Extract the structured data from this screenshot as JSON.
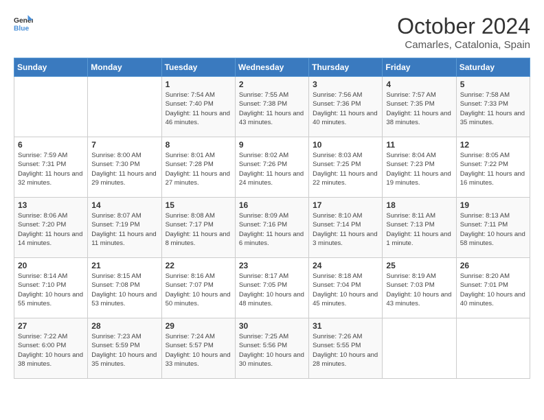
{
  "header": {
    "logo_general": "General",
    "logo_blue": "Blue",
    "title": "October 2024",
    "location": "Camarles, Catalonia, Spain"
  },
  "calendar": {
    "days_of_week": [
      "Sunday",
      "Monday",
      "Tuesday",
      "Wednesday",
      "Thursday",
      "Friday",
      "Saturday"
    ],
    "weeks": [
      [
        {
          "day": "",
          "sunrise": "",
          "sunset": "",
          "daylight": ""
        },
        {
          "day": "",
          "sunrise": "",
          "sunset": "",
          "daylight": ""
        },
        {
          "day": "1",
          "sunrise": "Sunrise: 7:54 AM",
          "sunset": "Sunset: 7:40 PM",
          "daylight": "Daylight: 11 hours and 46 minutes."
        },
        {
          "day": "2",
          "sunrise": "Sunrise: 7:55 AM",
          "sunset": "Sunset: 7:38 PM",
          "daylight": "Daylight: 11 hours and 43 minutes."
        },
        {
          "day": "3",
          "sunrise": "Sunrise: 7:56 AM",
          "sunset": "Sunset: 7:36 PM",
          "daylight": "Daylight: 11 hours and 40 minutes."
        },
        {
          "day": "4",
          "sunrise": "Sunrise: 7:57 AM",
          "sunset": "Sunset: 7:35 PM",
          "daylight": "Daylight: 11 hours and 38 minutes."
        },
        {
          "day": "5",
          "sunrise": "Sunrise: 7:58 AM",
          "sunset": "Sunset: 7:33 PM",
          "daylight": "Daylight: 11 hours and 35 minutes."
        }
      ],
      [
        {
          "day": "6",
          "sunrise": "Sunrise: 7:59 AM",
          "sunset": "Sunset: 7:31 PM",
          "daylight": "Daylight: 11 hours and 32 minutes."
        },
        {
          "day": "7",
          "sunrise": "Sunrise: 8:00 AM",
          "sunset": "Sunset: 7:30 PM",
          "daylight": "Daylight: 11 hours and 29 minutes."
        },
        {
          "day": "8",
          "sunrise": "Sunrise: 8:01 AM",
          "sunset": "Sunset: 7:28 PM",
          "daylight": "Daylight: 11 hours and 27 minutes."
        },
        {
          "day": "9",
          "sunrise": "Sunrise: 8:02 AM",
          "sunset": "Sunset: 7:26 PM",
          "daylight": "Daylight: 11 hours and 24 minutes."
        },
        {
          "day": "10",
          "sunrise": "Sunrise: 8:03 AM",
          "sunset": "Sunset: 7:25 PM",
          "daylight": "Daylight: 11 hours and 22 minutes."
        },
        {
          "day": "11",
          "sunrise": "Sunrise: 8:04 AM",
          "sunset": "Sunset: 7:23 PM",
          "daylight": "Daylight: 11 hours and 19 minutes."
        },
        {
          "day": "12",
          "sunrise": "Sunrise: 8:05 AM",
          "sunset": "Sunset: 7:22 PM",
          "daylight": "Daylight: 11 hours and 16 minutes."
        }
      ],
      [
        {
          "day": "13",
          "sunrise": "Sunrise: 8:06 AM",
          "sunset": "Sunset: 7:20 PM",
          "daylight": "Daylight: 11 hours and 14 minutes."
        },
        {
          "day": "14",
          "sunrise": "Sunrise: 8:07 AM",
          "sunset": "Sunset: 7:19 PM",
          "daylight": "Daylight: 11 hours and 11 minutes."
        },
        {
          "day": "15",
          "sunrise": "Sunrise: 8:08 AM",
          "sunset": "Sunset: 7:17 PM",
          "daylight": "Daylight: 11 hours and 8 minutes."
        },
        {
          "day": "16",
          "sunrise": "Sunrise: 8:09 AM",
          "sunset": "Sunset: 7:16 PM",
          "daylight": "Daylight: 11 hours and 6 minutes."
        },
        {
          "day": "17",
          "sunrise": "Sunrise: 8:10 AM",
          "sunset": "Sunset: 7:14 PM",
          "daylight": "Daylight: 11 hours and 3 minutes."
        },
        {
          "day": "18",
          "sunrise": "Sunrise: 8:11 AM",
          "sunset": "Sunset: 7:13 PM",
          "daylight": "Daylight: 11 hours and 1 minute."
        },
        {
          "day": "19",
          "sunrise": "Sunrise: 8:13 AM",
          "sunset": "Sunset: 7:11 PM",
          "daylight": "Daylight: 10 hours and 58 minutes."
        }
      ],
      [
        {
          "day": "20",
          "sunrise": "Sunrise: 8:14 AM",
          "sunset": "Sunset: 7:10 PM",
          "daylight": "Daylight: 10 hours and 55 minutes."
        },
        {
          "day": "21",
          "sunrise": "Sunrise: 8:15 AM",
          "sunset": "Sunset: 7:08 PM",
          "daylight": "Daylight: 10 hours and 53 minutes."
        },
        {
          "day": "22",
          "sunrise": "Sunrise: 8:16 AM",
          "sunset": "Sunset: 7:07 PM",
          "daylight": "Daylight: 10 hours and 50 minutes."
        },
        {
          "day": "23",
          "sunrise": "Sunrise: 8:17 AM",
          "sunset": "Sunset: 7:05 PM",
          "daylight": "Daylight: 10 hours and 48 minutes."
        },
        {
          "day": "24",
          "sunrise": "Sunrise: 8:18 AM",
          "sunset": "Sunset: 7:04 PM",
          "daylight": "Daylight: 10 hours and 45 minutes."
        },
        {
          "day": "25",
          "sunrise": "Sunrise: 8:19 AM",
          "sunset": "Sunset: 7:03 PM",
          "daylight": "Daylight: 10 hours and 43 minutes."
        },
        {
          "day": "26",
          "sunrise": "Sunrise: 8:20 AM",
          "sunset": "Sunset: 7:01 PM",
          "daylight": "Daylight: 10 hours and 40 minutes."
        }
      ],
      [
        {
          "day": "27",
          "sunrise": "Sunrise: 7:22 AM",
          "sunset": "Sunset: 6:00 PM",
          "daylight": "Daylight: 10 hours and 38 minutes."
        },
        {
          "day": "28",
          "sunrise": "Sunrise: 7:23 AM",
          "sunset": "Sunset: 5:59 PM",
          "daylight": "Daylight: 10 hours and 35 minutes."
        },
        {
          "day": "29",
          "sunrise": "Sunrise: 7:24 AM",
          "sunset": "Sunset: 5:57 PM",
          "daylight": "Daylight: 10 hours and 33 minutes."
        },
        {
          "day": "30",
          "sunrise": "Sunrise: 7:25 AM",
          "sunset": "Sunset: 5:56 PM",
          "daylight": "Daylight: 10 hours and 30 minutes."
        },
        {
          "day": "31",
          "sunrise": "Sunrise: 7:26 AM",
          "sunset": "Sunset: 5:55 PM",
          "daylight": "Daylight: 10 hours and 28 minutes."
        },
        {
          "day": "",
          "sunrise": "",
          "sunset": "",
          "daylight": ""
        },
        {
          "day": "",
          "sunrise": "",
          "sunset": "",
          "daylight": ""
        }
      ]
    ]
  }
}
